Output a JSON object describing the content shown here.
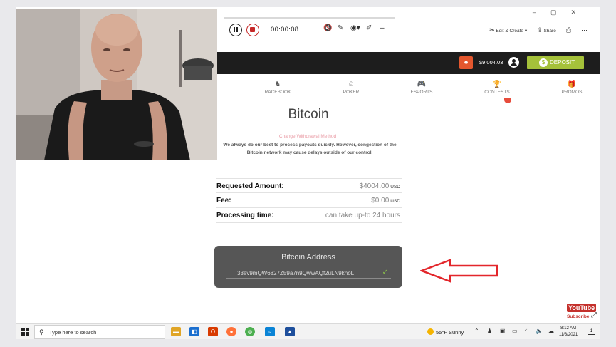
{
  "recorder": {
    "elapsed": "00:00:08"
  },
  "window_tools": {
    "edit_create": "Edit & Create",
    "share": "Share"
  },
  "header": {
    "balance": "$9,004.03",
    "deposit_label": "DEPOSIT"
  },
  "nav": [
    {
      "label": "RACEBOOK",
      "icon": "horse-icon"
    },
    {
      "label": "POKER",
      "icon": "cards-icon"
    },
    {
      "label": "ESPORTS",
      "icon": "gamepad-icon"
    },
    {
      "label": "CONTESTS",
      "icon": "trophy-icon"
    },
    {
      "label": "PROMOS",
      "icon": "gift-icon"
    }
  ],
  "withdrawal": {
    "method": "Bitcoin",
    "change_method": "Change Withdrawal Method",
    "notice": "We always do our best to process payouts quickly. However, congestion of the Bitcoin network may cause delays outside of our control.",
    "requested_label": "Requested Amount:",
    "requested_value": "$4004.00",
    "requested_currency": "USD",
    "fee_label": "Fee:",
    "fee_value": "$0.00",
    "fee_currency": "USD",
    "processing_label": "Processing time:",
    "processing_value": "can take up-to 24 hours",
    "address_title": "Bitcoin Address",
    "address_value": "33ev9mQW6827Z59a7n9QwwAQf2uLN9knoL"
  },
  "overlay": {
    "youtube": "YouTube",
    "subscribe": "Subscribe"
  },
  "taskbar": {
    "search_placeholder": "Type here to search",
    "weather": "55°F  Sunny",
    "time": "8:12 AM",
    "date": "11/3/2021"
  },
  "colors": {
    "accent_green": "#a5c13a",
    "arrow_red": "#e3262b",
    "header_bg": "#1d1d1d"
  }
}
